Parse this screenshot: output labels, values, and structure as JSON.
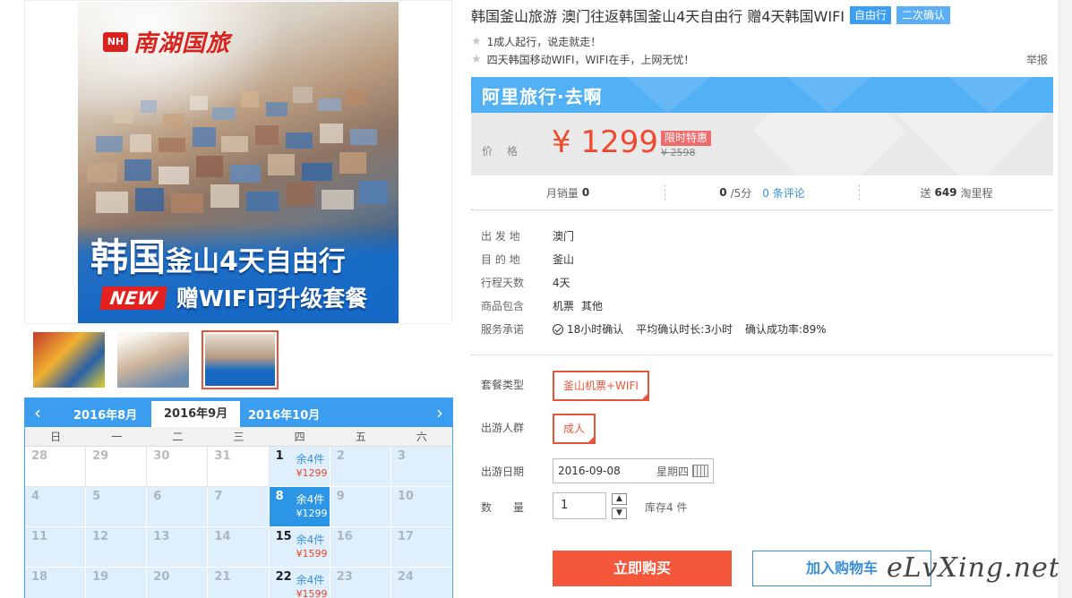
{
  "gallery": {
    "poster": {
      "brand": "南湖国旅",
      "brand_mark": "NH",
      "line1_big": "韩国",
      "line1_rest": "釜山4天自由行",
      "new_badge": "NEW",
      "line2": "赠WIFI可升级套餐"
    },
    "thumbnails": 3,
    "active_thumbnail": 3
  },
  "calendar": {
    "months": [
      "2016年8月",
      "2016年9月",
      "2016年10月"
    ],
    "active_month": "2016年9月",
    "weekdays": [
      "日",
      "一",
      "二",
      "三",
      "四",
      "五",
      "六"
    ],
    "rows": [
      [
        {
          "d": "28",
          "m": true
        },
        {
          "d": "29",
          "m": true
        },
        {
          "d": "30",
          "m": true
        },
        {
          "d": "31",
          "m": true
        },
        {
          "d": "1",
          "stock": "余4件",
          "price": "¥1299"
        },
        {
          "d": "2"
        },
        {
          "d": "3"
        }
      ],
      [
        {
          "d": "4"
        },
        {
          "d": "5"
        },
        {
          "d": "6"
        },
        {
          "d": "7"
        },
        {
          "d": "8",
          "stock": "余4件",
          "price": "¥1299",
          "sel": true
        },
        {
          "d": "9"
        },
        {
          "d": "10"
        }
      ],
      [
        {
          "d": "11"
        },
        {
          "d": "12"
        },
        {
          "d": "13"
        },
        {
          "d": "14"
        },
        {
          "d": "15",
          "stock": "余4件",
          "price": "¥1599"
        },
        {
          "d": "16"
        },
        {
          "d": "17"
        }
      ],
      [
        {
          "d": "18"
        },
        {
          "d": "19"
        },
        {
          "d": "20"
        },
        {
          "d": "21"
        },
        {
          "d": "22",
          "stock": "余4件",
          "price": "¥1599"
        },
        {
          "d": "23"
        },
        {
          "d": "24"
        }
      ]
    ]
  },
  "product": {
    "title": "韩国釜山旅游 澳门往返韩国釜山4天自由行 赠4天韩国WIFI",
    "tag_free": "自由行",
    "tag_confirm": "二次确认",
    "feature1": "1成人起行，说走就走！",
    "feature2": "四天韩国移动WIFI，WIFI在手，上网无忧！",
    "report": "举报"
  },
  "price": {
    "banner": "阿里旅行·去啊",
    "label": "价格",
    "value": "¥ 1299",
    "promo": "限时特惠",
    "original": "¥ 2598"
  },
  "stats": {
    "monthly_sales_label": "月销量",
    "monthly_sales": "0",
    "rating": "0",
    "rating_suffix": "/5分",
    "reviews": "0 条评论",
    "points_prefix": "送",
    "points": "649",
    "points_suffix": "淘里程"
  },
  "details": {
    "depart_label": "出 发 地",
    "depart": "澳门",
    "dest_label": "目 的 地",
    "dest": "釜山",
    "days_label": "行程天数",
    "days": "4天",
    "includes_label": "商品包含",
    "includes_1": "机票",
    "includes_2": "其他",
    "service_label": "服务承诺",
    "service_1": "18小时确认",
    "service_2": "平均确认时长:3小时",
    "service_3": "确认成功率:89%"
  },
  "options": {
    "package_label": "套餐类型",
    "package_value": "釜山机票+WIFI",
    "people_label": "出游人群",
    "people_value": "成人",
    "date_label": "出游日期",
    "date_value": "2016-09-08",
    "date_weekday": "星期四",
    "qty_label": "数　　量",
    "qty_value": "1",
    "stock": "库存4 件"
  },
  "actions": {
    "buy": "立即购买",
    "cart": "加入购物车"
  },
  "watermark": "eLvXing.net",
  "colors": {
    "accent_red": "#f5573a",
    "accent_blue": "#3a9df0"
  }
}
